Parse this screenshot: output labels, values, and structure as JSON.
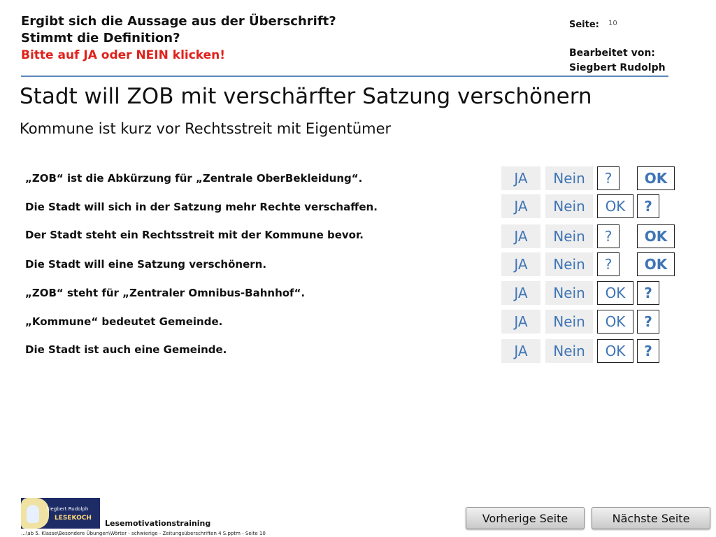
{
  "header": {
    "question_line1": "Ergibt sich die Aussage aus der Überschrift?",
    "question_line2": "Stimmt die Definition?",
    "instruction": "Bitte auf JA oder NEIN klicken!",
    "page_label": "Seite:",
    "page_number": "10",
    "edited_by_label": "Bearbeitet von:",
    "author": "Siegbert Rudolph"
  },
  "title": "Stadt will ZOB mit verschärfter Satzung verschönern",
  "subtitle": "Kommune ist kurz vor Rechtsstreit mit Eigentümer",
  "statements": [
    {
      "text": "„ZOB“ ist die Abkürzung für „Zentrale OberBekleidung“.",
      "ja": "JA",
      "nein": "Nein",
      "mark1": "?",
      "mark2": "OK"
    },
    {
      "text": "Die Stadt will sich in der Satzung mehr Rechte verschaffen.",
      "ja": "JA",
      "nein": "Nein",
      "mark1": "OK",
      "mark2": "?"
    },
    {
      "text": "Der Stadt steht ein Rechtsstreit mit der Kommune bevor.",
      "ja": "JA",
      "nein": "Nein",
      "mark1": "?",
      "mark2": "OK"
    },
    {
      "text": "Die Stadt will eine Satzung verschönern.",
      "ja": "JA",
      "nein": "Nein",
      "mark1": "?",
      "mark2": "OK"
    },
    {
      "text": "„ZOB“ steht für „Zentraler Omnibus-Bahnhof“.",
      "ja": "JA",
      "nein": "Nein",
      "mark1": "OK",
      "mark2": "?"
    },
    {
      "text": "„Kommune“ bedeutet Gemeinde.",
      "ja": "JA",
      "nein": "Nein",
      "mark1": "OK",
      "mark2": "?"
    },
    {
      "text": "Die Stadt ist auch eine Gemeinde.",
      "ja": "JA",
      "nein": "Nein",
      "mark1": "OK",
      "mark2": "?"
    }
  ],
  "footer": {
    "logo_line1": "Siegbert Rudolph",
    "logo_line2": "LESEKOCH",
    "program": "Lesemotivationstraining",
    "path": "…\\ab 5. Klasse\\Besondere Übungen\\Wörter - schwierige - Zeitungsüberschriften 4 S.pptm - Seite 10",
    "prev": "Vorherige Seite",
    "next": "Nächste Seite"
  },
  "colors": {
    "accent": "#3f75b5",
    "warning": "#e0201b",
    "rule": "#5b87b8"
  }
}
